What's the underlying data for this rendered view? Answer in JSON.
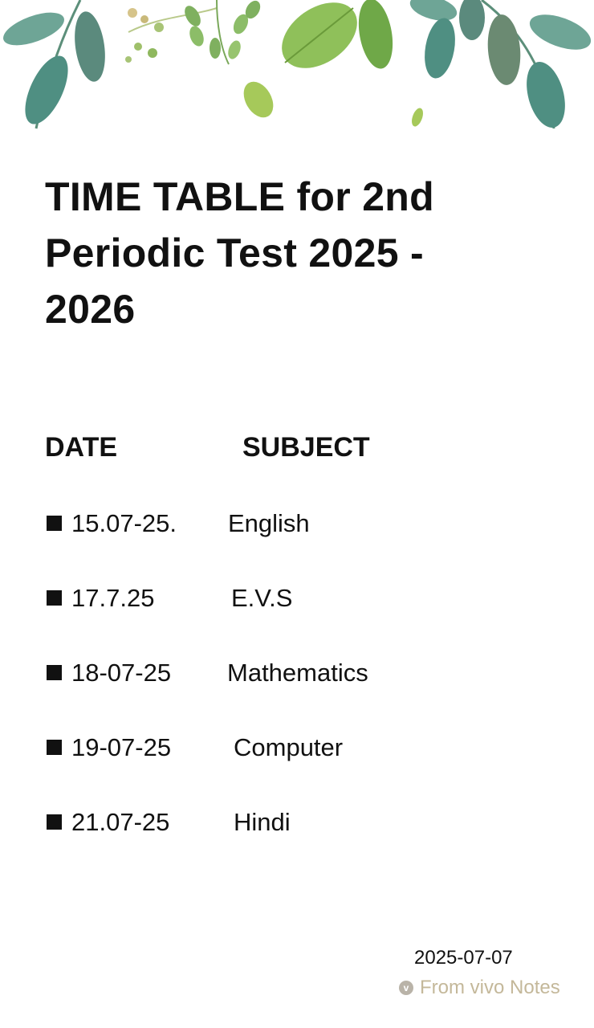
{
  "note": {
    "title": "TIME TABLE for 2nd\nPeriodic  Test  2025 -\n2026",
    "headers": {
      "date": "DATE",
      "subject": "SUBJECT"
    },
    "rows": [
      {
        "date": "15.07-25.",
        "subject": "English"
      },
      {
        "date": "17.7.25",
        "subject": "E.V.S"
      },
      {
        "date": "18-07-25",
        "subject": "Mathematics"
      },
      {
        "date": "19-07-25",
        "subject": "Computer"
      },
      {
        "date": "21.07-25",
        "subject": "Hindi"
      }
    ],
    "bullet_icon": "black-square-bullet",
    "decoration": "watercolor-leaves-banner"
  },
  "footer": {
    "date": "2025-07-07",
    "source_icon": "vivo-logo-icon",
    "source_icon_glyph": "v",
    "source": "From vivo Notes"
  },
  "colors": {
    "text": "#111111",
    "footer_source": "#c4b89a",
    "leaf_dark": "#4f8f82",
    "leaf_light": "#8fc05a"
  }
}
